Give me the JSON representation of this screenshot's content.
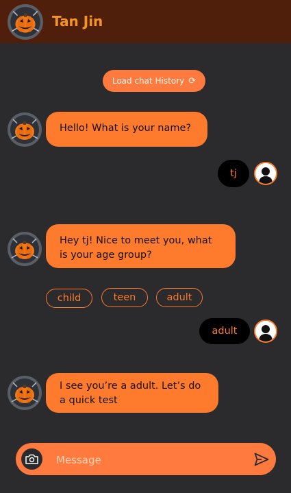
{
  "header": {
    "title": "Tan Jin",
    "avatar_icon": "jack-o-lantern-icon"
  },
  "history_button": {
    "label": "Load chat History",
    "icon": "refresh-icon"
  },
  "messages": [
    {
      "from": "bot",
      "text": "Hello! What is your name?"
    },
    {
      "from": "user",
      "text": "tj"
    },
    {
      "from": "bot",
      "text": "Hey tj! Nice to meet you, what is your age group?"
    },
    {
      "from": "user",
      "text": "adult"
    },
    {
      "from": "bot",
      "text": "I see you’re a adult. Let’s do a quick test"
    }
  ],
  "options": [
    "child",
    "teen",
    "adult"
  ],
  "composer": {
    "placeholder": "Message",
    "camera_icon": "camera-icon",
    "send_icon": "send-icon"
  },
  "colors": {
    "accent": "#fe7a2d",
    "header": "#4f1f0c",
    "background": "#2b2a2c",
    "title": "#f7941d"
  }
}
